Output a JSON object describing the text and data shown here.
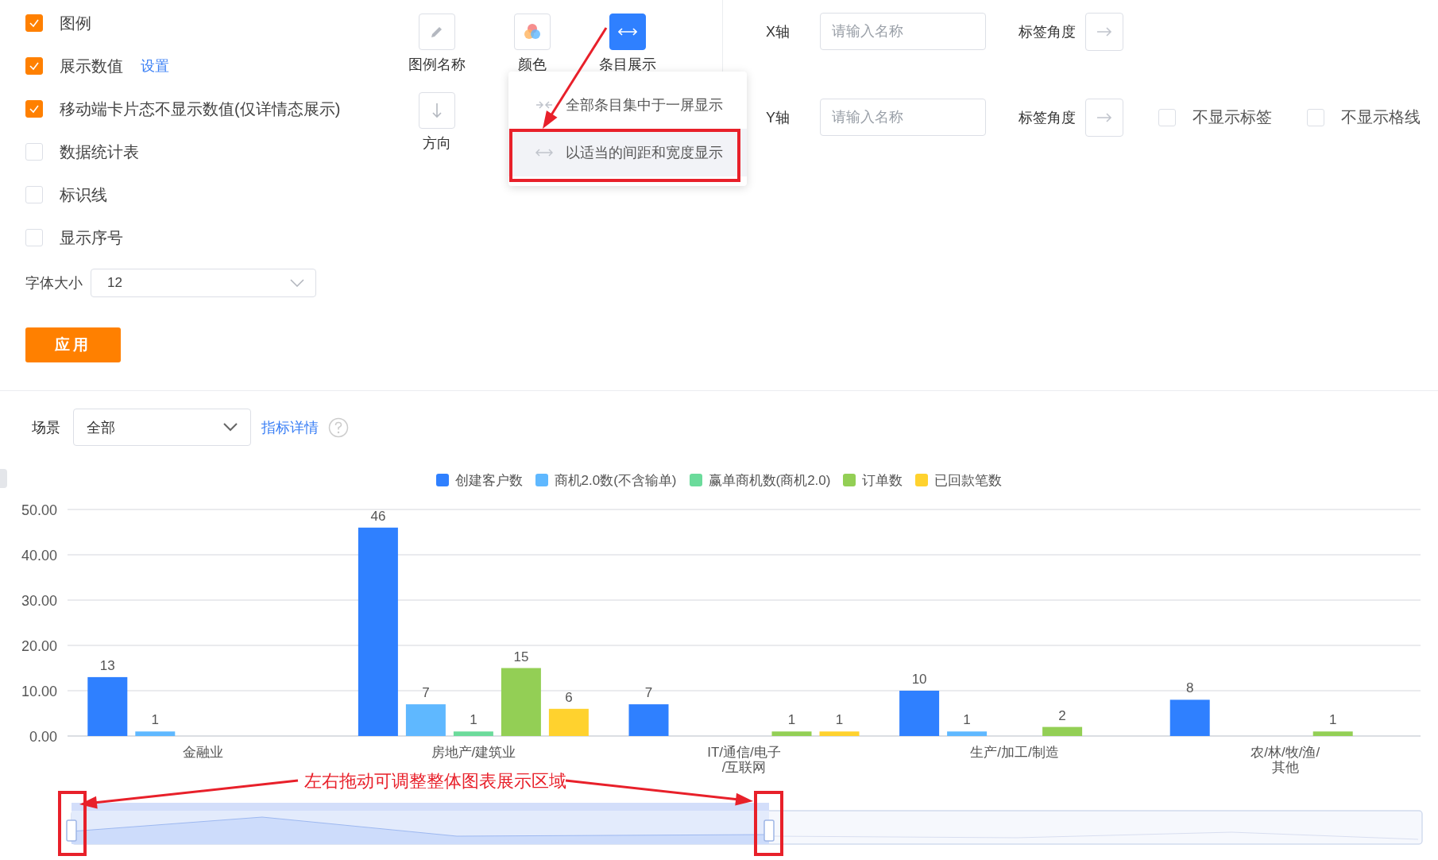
{
  "options": {
    "checkboxes": [
      {
        "label": "图例",
        "checked": true
      },
      {
        "label": "展示数值",
        "checked": true,
        "link": "设置"
      },
      {
        "label": "移动端卡片态不显示数值(仅详情态展示)",
        "checked": true
      },
      {
        "label": "数据统计表",
        "checked": false
      },
      {
        "label": "标识线",
        "checked": false
      },
      {
        "label": "显示序号",
        "checked": false
      }
    ],
    "font_size": {
      "label": "字体大小",
      "value": "12"
    },
    "apply_button": "应用"
  },
  "style_tools": [
    {
      "label": "图例名称",
      "selected": false
    },
    {
      "label": "颜色",
      "selected": false
    },
    {
      "label": "条目展示",
      "selected": true
    },
    {
      "label": "方向",
      "selected": false
    }
  ],
  "display_menu": {
    "items": [
      {
        "label": "全部条目集中于一屏显示",
        "selected": false
      },
      {
        "label": "以适当的间距和宽度显示",
        "selected": true
      }
    ]
  },
  "axes": [
    {
      "label": "X轴",
      "placeholder": "请输入名称",
      "angle_label": "标签角度"
    },
    {
      "label": "Y轴",
      "placeholder": "请输入名称",
      "angle_label": "标签角度",
      "options": [
        {
          "label": "不显示标签",
          "checked": false
        },
        {
          "label": "不显示格线",
          "checked": false
        }
      ]
    }
  ],
  "filter": {
    "label": "场景",
    "value": "全部",
    "link": "指标详情"
  },
  "chart_data": {
    "type": "bar",
    "categories": [
      "金融业",
      "房地产/建筑业",
      "IT/通信/电子\n/互联网",
      "生产/加工/制造",
      "农/林/牧/渔/\n其他"
    ],
    "series": [
      {
        "name": "创建客户数",
        "color": "#2f80ff",
        "values": [
          13,
          46,
          7,
          10,
          8
        ]
      },
      {
        "name": "商机2.0数(不含输单)",
        "color": "#5fb8ff",
        "values": [
          1,
          7,
          null,
          1,
          null
        ]
      },
      {
        "name": "赢单商机数(商机2.0)",
        "color": "#6bdb9b",
        "values": [
          null,
          1,
          null,
          null,
          null
        ]
      },
      {
        "name": "订单数",
        "color": "#93cf55",
        "values": [
          null,
          15,
          1,
          2,
          1
        ]
      },
      {
        "name": "已回款笔数",
        "color": "#ffd22e",
        "values": [
          null,
          6,
          1,
          null,
          null
        ]
      }
    ],
    "ylim": [
      0,
      50
    ],
    "yticks": [
      {
        "value": 0,
        "label": "0.00"
      },
      {
        "value": 10,
        "label": "10.00"
      },
      {
        "value": 20,
        "label": "20.00"
      },
      {
        "value": 30,
        "label": "30.00"
      },
      {
        "value": 40,
        "label": "40.00"
      },
      {
        "value": 50,
        "label": "50.00"
      }
    ],
    "data_labels": true,
    "grid": true
  },
  "annotation": {
    "text": "左右拖动可调整整体图表展示区域"
  }
}
